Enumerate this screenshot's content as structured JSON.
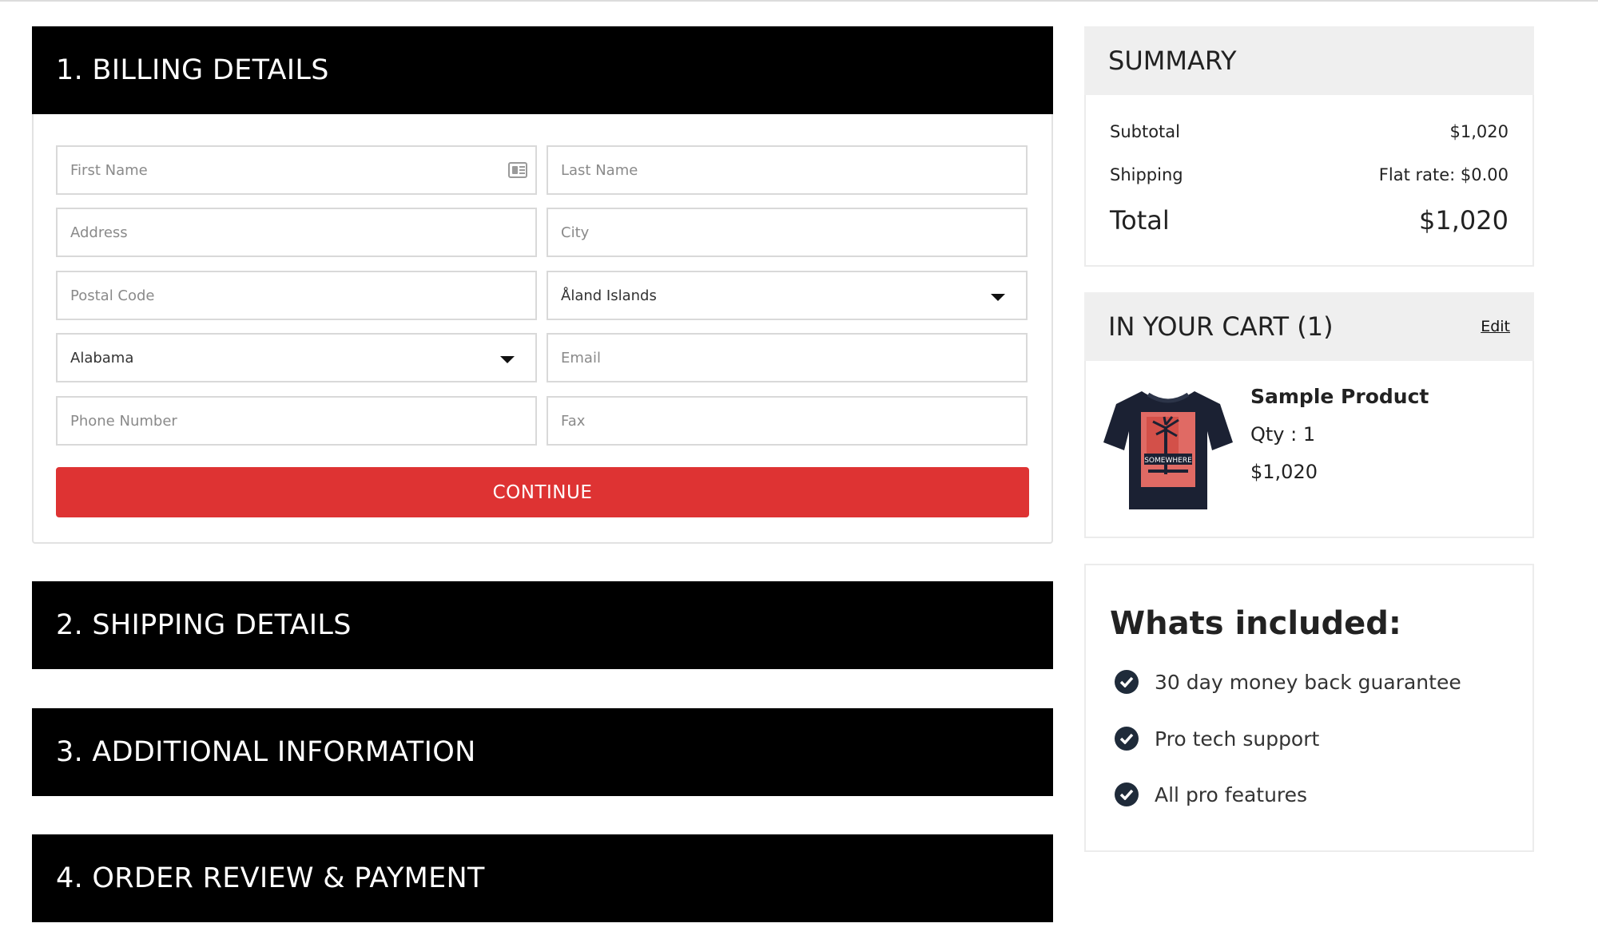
{
  "sections": [
    {
      "label": "1. BILLING DETAILS"
    },
    {
      "label": "2. SHIPPING DETAILS"
    },
    {
      "label": "3. ADDITIONAL INFORMATION"
    },
    {
      "label": "4. ORDER REVIEW & PAYMENT"
    }
  ],
  "billing": {
    "first_name_placeholder": "First Name",
    "last_name_placeholder": "Last Name",
    "address_placeholder": "Address",
    "city_placeholder": "City",
    "postal_code_placeholder": "Postal Code",
    "country_value": "Åland Islands",
    "state_value": "Alabama",
    "email_placeholder": "Email",
    "phone_placeholder": "Phone Number",
    "fax_placeholder": "Fax",
    "continue_label": "CONTINUE"
  },
  "summary": {
    "title": "SUMMARY",
    "subtotal_label": "Subtotal",
    "subtotal_value": "$1,020",
    "shipping_label": "Shipping",
    "shipping_value": "Flat rate: $0.00",
    "total_label": "Total",
    "total_value": "$1,020"
  },
  "cart": {
    "title": "IN YOUR CART (1)",
    "edit_label": "Edit",
    "item": {
      "name": "Sample Product",
      "qty": "Qty : 1",
      "price": "$1,020",
      "shirt_text": "SOMEWHERE"
    }
  },
  "included": {
    "title": "Whats included:",
    "features": [
      "30 day money back guarantee",
      "Pro tech support",
      "All pro features"
    ]
  },
  "colors": {
    "header_bg": "#000000",
    "accent": "#de3333",
    "panel_bg": "#efefef",
    "check_bg": "#1f2b3a"
  }
}
